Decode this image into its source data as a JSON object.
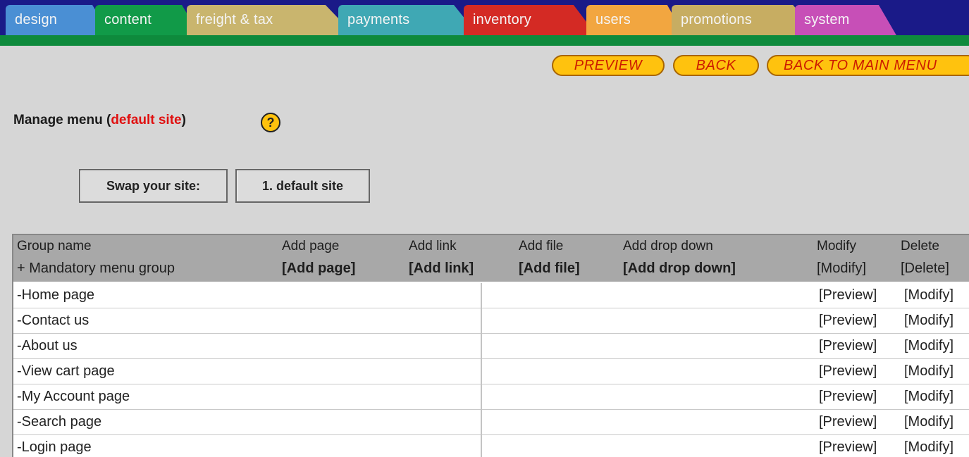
{
  "tabs": [
    {
      "label": "design",
      "color": "#4a8fd4"
    },
    {
      "label": "content",
      "color": "#119a48"
    },
    {
      "label": "freight & tax",
      "color": "#c9b56e"
    },
    {
      "label": "payments",
      "color": "#3fa8b4"
    },
    {
      "label": "inventory",
      "color": "#d42a24"
    },
    {
      "label": "users",
      "color": "#f2a640"
    },
    {
      "label": "promotions",
      "color": "#c7ad62"
    },
    {
      "label": "system",
      "color": "#c74fb7"
    }
  ],
  "actions": {
    "preview": "PREVIEW",
    "back": "BACK",
    "back_main": "BACK TO MAIN MENU"
  },
  "heading": {
    "prefix": "Manage menu (",
    "site": "default site",
    "suffix": ")",
    "help": "?"
  },
  "swap": {
    "label": "Swap your site:",
    "value": "1. default site"
  },
  "table": {
    "headers": [
      "Group name",
      "Add page",
      "Add link",
      "Add file",
      "Add drop down",
      "Modify",
      "Delete"
    ],
    "group": {
      "name": "+ Mandatory menu group",
      "add_page": "[Add page]",
      "add_link": "[Add link]",
      "add_file": "[Add file]",
      "add_dropdown": "[Add drop down]",
      "modify": "[Modify]",
      "delete": "[Delete]"
    },
    "row_preview": "[Preview]",
    "row_modify": "[Modify]",
    "rows": [
      "-Home page",
      "-Contact us",
      "-About us",
      "-View cart page",
      "-My Account page",
      "-Search page",
      "-Login page"
    ]
  }
}
